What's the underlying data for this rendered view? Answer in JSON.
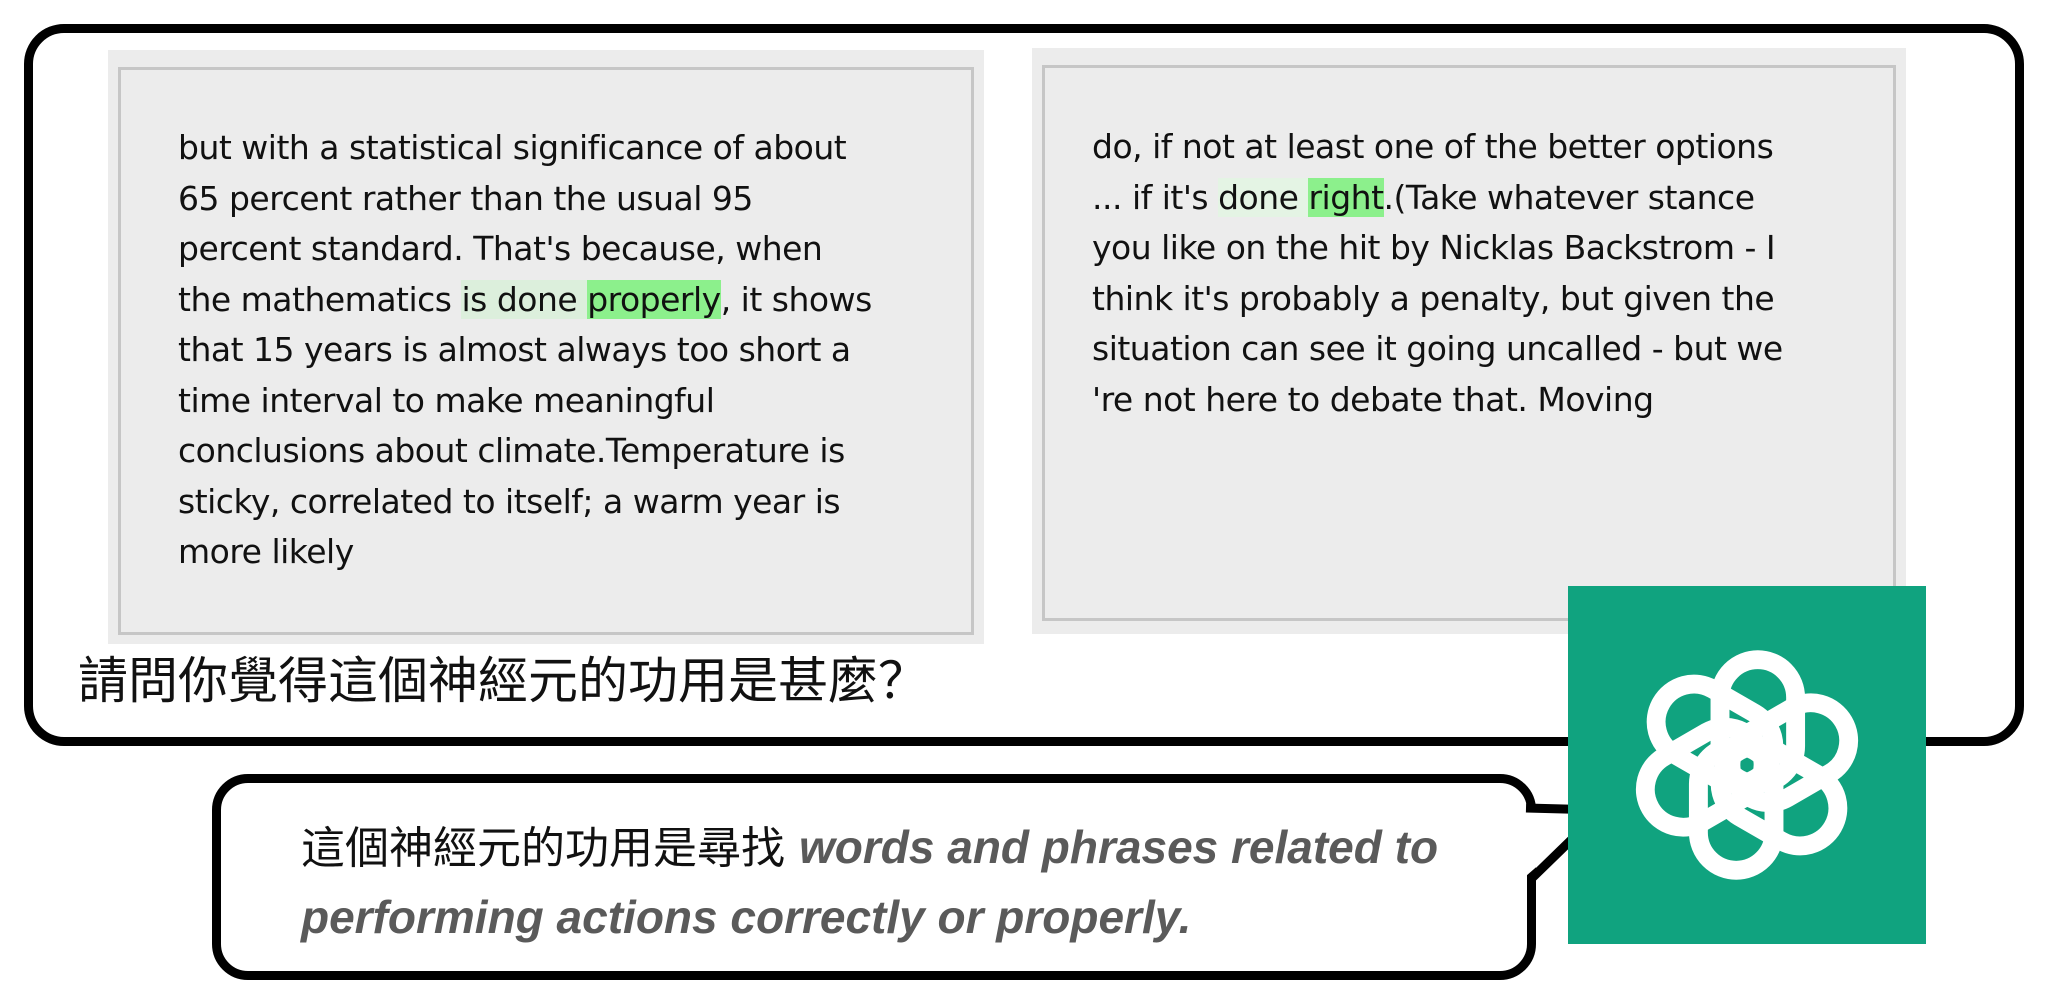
{
  "left_panel": {
    "lines": [
      "but with a statistical significance of about",
      "65 percent rather than the usual 95",
      "percent standard. That's because, when",
      "the mathematics is done properly, it shows",
      "that 15 years is almost always too short a",
      "time interval to make meaningful",
      "conclusions about climate.Temperature is",
      "sticky, correlated to itself; a warm year is",
      "more likely"
    ],
    "highlight_weak": "done",
    "highlight_strong": "properly"
  },
  "right_panel": {
    "lines": [
      "do, if not at least one of the better options",
      "... if it's done right.(Take whatever stance",
      "you like on the hit by Nicklas Backstrom - I",
      "think it's probably a penalty, but given the",
      "situation can see it going uncalled - but we",
      "'re not here to debate that. Moving"
    ],
    "highlight_strong": "right"
  },
  "question": "請問你覺得這個神經元的功用是甚麼？",
  "answer": {
    "prefix": "這個神經元的功用是尋找",
    "explanation": "words and phrases related to performing actions correctly or properly."
  },
  "logo": {
    "icon": "openai-logo-icon",
    "background": "#10a37f",
    "color": "#ffffff"
  },
  "colors": {
    "highlight_strong": "#8cf08c",
    "highlight_light": "#dcefdc",
    "panel_background": "#ececec"
  }
}
